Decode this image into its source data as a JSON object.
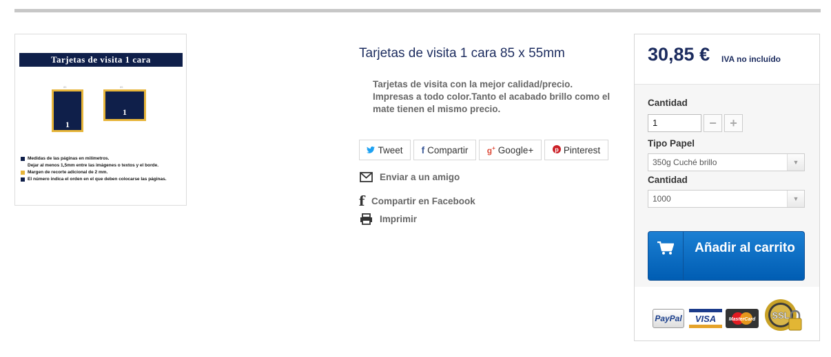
{
  "product_image": {
    "banner": "Tarjetas de visita 1 cara",
    "card1_number": "1",
    "card2_number": "1",
    "legend": [
      "Medidas de las páginas en milímetros.",
      "Dejar al menos 1,5mm entre las imágenes o textos y el borde.",
      "Margen de recorte adicional de 2 mm.",
      "El número indica el orden en el que deben colocarse las páginas."
    ]
  },
  "product": {
    "title": "Tarjetas de visita 1 cara 85 x 55mm",
    "description": "Tarjetas de visita con la mejor calidad/precio. Impresas a todo color.Tanto el acabado brillo como el mate tienen el mismo precio."
  },
  "share": {
    "tweet": "Tweet",
    "facebook": "Compartir",
    "google": "Google+",
    "pinterest": "Pinterest"
  },
  "actions": {
    "send_friend": "Enviar a un amigo",
    "share_facebook": "Compartir en Facebook",
    "print": "Imprimir"
  },
  "buybox": {
    "price": "30,85 €",
    "tax_note": "IVA no incluído",
    "quantity_label": "Cantidad",
    "quantity_value": "1",
    "minus": "−",
    "plus": "+",
    "paper_label": "Tipo Papel",
    "paper_value": "350g Cuché brillo",
    "amount_label": "Cantidad",
    "amount_value": "1000",
    "add_to_cart": "Añadir al carrito"
  },
  "payments": {
    "paypal": "PayPal",
    "visa": "VISA",
    "mastercard": "MasterCard",
    "ssl": "SSL"
  },
  "colors": {
    "navy": "#1b2b5e",
    "cart_blue": "#0066c0",
    "gold": "#e7b53a"
  }
}
